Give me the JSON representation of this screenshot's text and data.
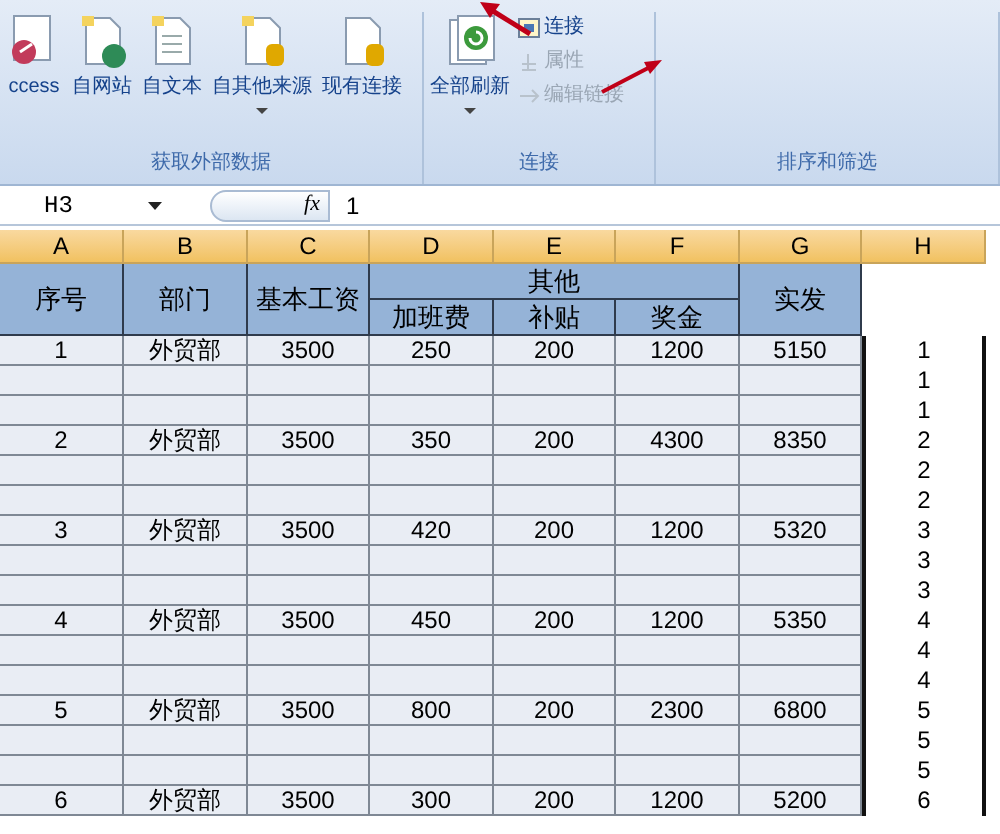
{
  "ribbon": {
    "groups": [
      {
        "label": "获取外部数据",
        "buttons": [
          {
            "kind": "database",
            "label": "ccess",
            "has_menu": false
          },
          {
            "kind": "web",
            "label": "自网站",
            "has_menu": false
          },
          {
            "kind": "text",
            "label": "自文本",
            "has_menu": false
          },
          {
            "kind": "other",
            "label": "自其他来源",
            "has_menu": true
          },
          {
            "kind": "existing",
            "label": "现有连接",
            "has_menu": false
          }
        ]
      },
      {
        "label": "连接",
        "buttons": [
          {
            "kind": "refresh",
            "label": "全部刷新",
            "has_menu": true
          }
        ],
        "small_buttons": [
          {
            "kind": "connections",
            "label": "连接",
            "disabled": false
          },
          {
            "kind": "properties",
            "label": "属性",
            "disabled": true
          },
          {
            "kind": "links",
            "label": "编辑链接",
            "disabled": true
          }
        ]
      },
      {
        "label": "排序和筛选"
      }
    ]
  },
  "formula_bar": {
    "name_box": "H3",
    "function_label": "fx",
    "formula": "1"
  },
  "columns": [
    "A",
    "B",
    "C",
    "D",
    "E",
    "F",
    "G",
    "H"
  ],
  "header": {
    "top": [
      "序号",
      "部门",
      "基本工资"
    ],
    "group": "其他",
    "sub": [
      "加班费",
      "补贴",
      "奖金"
    ],
    "last": "实发"
  },
  "records": [
    {
      "cells": [
        "1",
        "外贸部",
        "3500",
        "250",
        "200",
        "1200",
        "5150"
      ],
      "h_values": [
        "1",
        "1",
        "1"
      ]
    },
    {
      "cells": [
        "2",
        "外贸部",
        "3500",
        "350",
        "200",
        "4300",
        "8350"
      ],
      "h_values": [
        "2",
        "2",
        "2"
      ]
    },
    {
      "cells": [
        "3",
        "外贸部",
        "3500",
        "420",
        "200",
        "1200",
        "5320"
      ],
      "h_values": [
        "3",
        "3",
        "3"
      ]
    },
    {
      "cells": [
        "4",
        "外贸部",
        "3500",
        "450",
        "200",
        "1200",
        "5350"
      ],
      "h_values": [
        "4",
        "4",
        "4"
      ]
    },
    {
      "cells": [
        "5",
        "外贸部",
        "3500",
        "800",
        "200",
        "2300",
        "6800"
      ],
      "h_values": [
        "5",
        "5",
        "5"
      ]
    },
    {
      "cells": [
        "6",
        "外贸部",
        "3500",
        "300",
        "200",
        "1200",
        "5200"
      ],
      "h_values": [
        "6"
      ]
    }
  ]
}
